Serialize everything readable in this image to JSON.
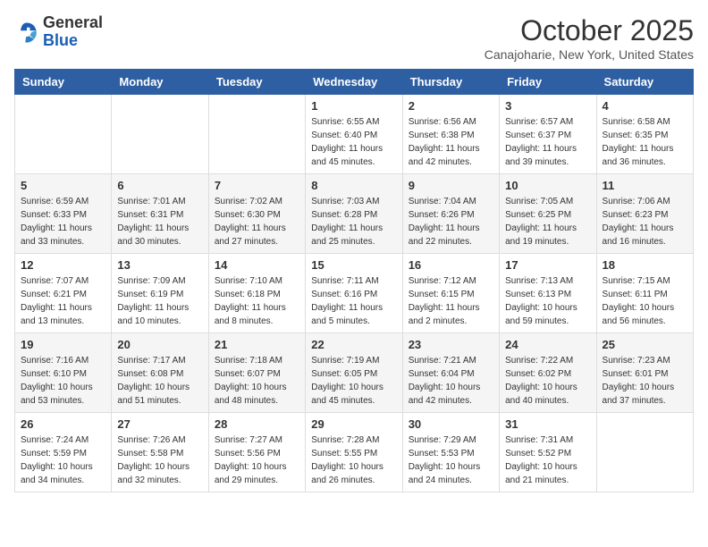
{
  "header": {
    "logo_general": "General",
    "logo_blue": "Blue",
    "month_title": "October 2025",
    "location": "Canajoharie, New York, United States"
  },
  "days_of_week": [
    "Sunday",
    "Monday",
    "Tuesday",
    "Wednesday",
    "Thursday",
    "Friday",
    "Saturday"
  ],
  "weeks": [
    [
      {
        "day": "",
        "info": ""
      },
      {
        "day": "",
        "info": ""
      },
      {
        "day": "",
        "info": ""
      },
      {
        "day": "1",
        "info": "Sunrise: 6:55 AM\nSunset: 6:40 PM\nDaylight: 11 hours\nand 45 minutes."
      },
      {
        "day": "2",
        "info": "Sunrise: 6:56 AM\nSunset: 6:38 PM\nDaylight: 11 hours\nand 42 minutes."
      },
      {
        "day": "3",
        "info": "Sunrise: 6:57 AM\nSunset: 6:37 PM\nDaylight: 11 hours\nand 39 minutes."
      },
      {
        "day": "4",
        "info": "Sunrise: 6:58 AM\nSunset: 6:35 PM\nDaylight: 11 hours\nand 36 minutes."
      }
    ],
    [
      {
        "day": "5",
        "info": "Sunrise: 6:59 AM\nSunset: 6:33 PM\nDaylight: 11 hours\nand 33 minutes."
      },
      {
        "day": "6",
        "info": "Sunrise: 7:01 AM\nSunset: 6:31 PM\nDaylight: 11 hours\nand 30 minutes."
      },
      {
        "day": "7",
        "info": "Sunrise: 7:02 AM\nSunset: 6:30 PM\nDaylight: 11 hours\nand 27 minutes."
      },
      {
        "day": "8",
        "info": "Sunrise: 7:03 AM\nSunset: 6:28 PM\nDaylight: 11 hours\nand 25 minutes."
      },
      {
        "day": "9",
        "info": "Sunrise: 7:04 AM\nSunset: 6:26 PM\nDaylight: 11 hours\nand 22 minutes."
      },
      {
        "day": "10",
        "info": "Sunrise: 7:05 AM\nSunset: 6:25 PM\nDaylight: 11 hours\nand 19 minutes."
      },
      {
        "day": "11",
        "info": "Sunrise: 7:06 AM\nSunset: 6:23 PM\nDaylight: 11 hours\nand 16 minutes."
      }
    ],
    [
      {
        "day": "12",
        "info": "Sunrise: 7:07 AM\nSunset: 6:21 PM\nDaylight: 11 hours\nand 13 minutes."
      },
      {
        "day": "13",
        "info": "Sunrise: 7:09 AM\nSunset: 6:19 PM\nDaylight: 11 hours\nand 10 minutes."
      },
      {
        "day": "14",
        "info": "Sunrise: 7:10 AM\nSunset: 6:18 PM\nDaylight: 11 hours\nand 8 minutes."
      },
      {
        "day": "15",
        "info": "Sunrise: 7:11 AM\nSunset: 6:16 PM\nDaylight: 11 hours\nand 5 minutes."
      },
      {
        "day": "16",
        "info": "Sunrise: 7:12 AM\nSunset: 6:15 PM\nDaylight: 11 hours\nand 2 minutes."
      },
      {
        "day": "17",
        "info": "Sunrise: 7:13 AM\nSunset: 6:13 PM\nDaylight: 10 hours\nand 59 minutes."
      },
      {
        "day": "18",
        "info": "Sunrise: 7:15 AM\nSunset: 6:11 PM\nDaylight: 10 hours\nand 56 minutes."
      }
    ],
    [
      {
        "day": "19",
        "info": "Sunrise: 7:16 AM\nSunset: 6:10 PM\nDaylight: 10 hours\nand 53 minutes."
      },
      {
        "day": "20",
        "info": "Sunrise: 7:17 AM\nSunset: 6:08 PM\nDaylight: 10 hours\nand 51 minutes."
      },
      {
        "day": "21",
        "info": "Sunrise: 7:18 AM\nSunset: 6:07 PM\nDaylight: 10 hours\nand 48 minutes."
      },
      {
        "day": "22",
        "info": "Sunrise: 7:19 AM\nSunset: 6:05 PM\nDaylight: 10 hours\nand 45 minutes."
      },
      {
        "day": "23",
        "info": "Sunrise: 7:21 AM\nSunset: 6:04 PM\nDaylight: 10 hours\nand 42 minutes."
      },
      {
        "day": "24",
        "info": "Sunrise: 7:22 AM\nSunset: 6:02 PM\nDaylight: 10 hours\nand 40 minutes."
      },
      {
        "day": "25",
        "info": "Sunrise: 7:23 AM\nSunset: 6:01 PM\nDaylight: 10 hours\nand 37 minutes."
      }
    ],
    [
      {
        "day": "26",
        "info": "Sunrise: 7:24 AM\nSunset: 5:59 PM\nDaylight: 10 hours\nand 34 minutes."
      },
      {
        "day": "27",
        "info": "Sunrise: 7:26 AM\nSunset: 5:58 PM\nDaylight: 10 hours\nand 32 minutes."
      },
      {
        "day": "28",
        "info": "Sunrise: 7:27 AM\nSunset: 5:56 PM\nDaylight: 10 hours\nand 29 minutes."
      },
      {
        "day": "29",
        "info": "Sunrise: 7:28 AM\nSunset: 5:55 PM\nDaylight: 10 hours\nand 26 minutes."
      },
      {
        "day": "30",
        "info": "Sunrise: 7:29 AM\nSunset: 5:53 PM\nDaylight: 10 hours\nand 24 minutes."
      },
      {
        "day": "31",
        "info": "Sunrise: 7:31 AM\nSunset: 5:52 PM\nDaylight: 10 hours\nand 21 minutes."
      },
      {
        "day": "",
        "info": ""
      }
    ]
  ],
  "gray_rows": [
    1,
    3
  ]
}
